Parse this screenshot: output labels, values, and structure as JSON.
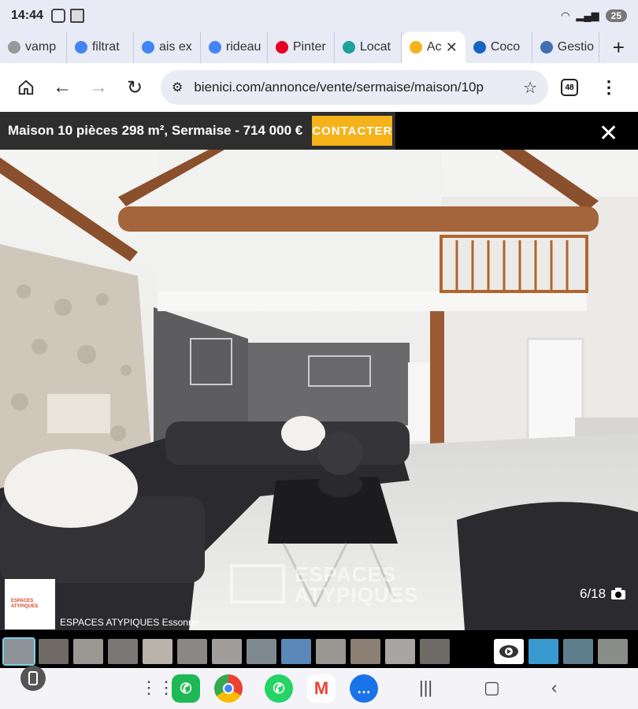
{
  "status": {
    "time": "14:44",
    "battery": "25"
  },
  "tabs": [
    {
      "label": "vamp",
      "icon": "site-icon",
      "color": "#999999"
    },
    {
      "label": "filtrat",
      "icon": "google-icon",
      "color": "#4285f4"
    },
    {
      "label": "ais ex",
      "icon": "google-icon",
      "color": "#4285f4"
    },
    {
      "label": "rideau",
      "icon": "google-icon",
      "color": "#4285f4"
    },
    {
      "label": "Pinter",
      "icon": "pinterest-icon",
      "color": "#e60023"
    },
    {
      "label": "Locat",
      "icon": "location-icon",
      "color": "#1ba39c"
    },
    {
      "label": "Ac",
      "icon": "bienici-icon",
      "color": "#f5b21b",
      "active": true
    },
    {
      "label": "Coco",
      "icon": "coco-icon",
      "color": "#1565c0"
    },
    {
      "label": "Gestio",
      "icon": "shield-icon",
      "color": "#3f6fb0"
    }
  ],
  "browser": {
    "url": "bienici.com/annonce/vente/sermaise/maison/10p",
    "tab_count": "48"
  },
  "listing": {
    "title": "Maison 10 pièces 298 m², Sermaise - 714 000 €",
    "contact_label": "CONTACTER"
  },
  "gallery": {
    "agency_logo_text": "ESPACES ATYPIQUES",
    "agency_name": "ESPACES ATYPIQUES Essonne",
    "counter": "6/18",
    "watermark_line1": "ESPACES",
    "watermark_line2": "ATYPIQUES"
  },
  "colors": {
    "accent": "#f5b21b",
    "bar": "#2e2e2e"
  }
}
